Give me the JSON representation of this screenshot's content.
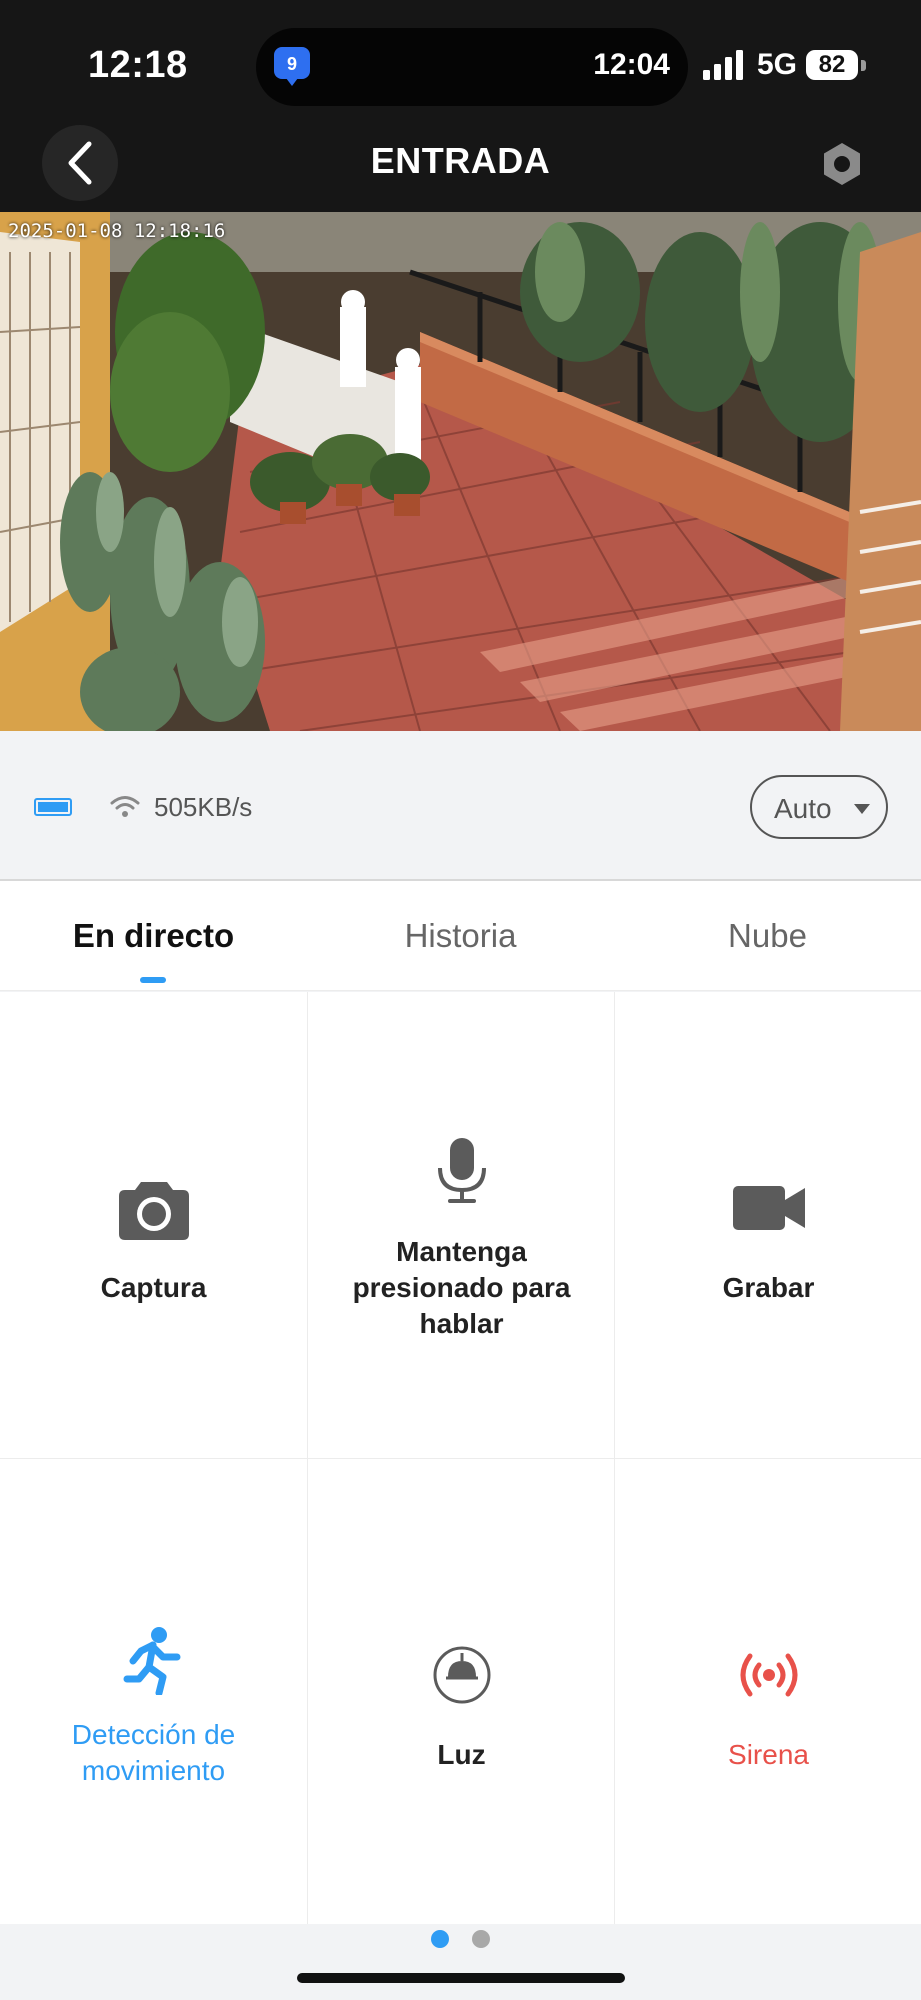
{
  "status_bar": {
    "time": "12:18",
    "island_time": "12:04",
    "island_badge": "9",
    "network": "5G",
    "battery": "82"
  },
  "header": {
    "title": "ENTRADA"
  },
  "video": {
    "timestamp": "2025-01-08 12:18:16"
  },
  "info_bar": {
    "speed": "505KB/s",
    "quality": "Auto"
  },
  "tabs": [
    {
      "label": "En directo",
      "active": true
    },
    {
      "label": "Historia",
      "active": false
    },
    {
      "label": "Nube",
      "active": false
    }
  ],
  "controls": [
    {
      "label": "Captura",
      "icon": "camera-icon"
    },
    {
      "label": "Mantenga presionado para hablar",
      "icon": "microphone-icon"
    },
    {
      "label": "Grabar",
      "icon": "video-camera-icon"
    },
    {
      "label": "Detección de movimiento",
      "icon": "running-person-icon"
    },
    {
      "label": "Luz",
      "icon": "lamp-icon"
    },
    {
      "label": "Sirena",
      "icon": "siren-icon"
    }
  ],
  "pager": {
    "pages": 2,
    "current": 1
  },
  "colors": {
    "accent": "#2f9cf4",
    "siren": "#e8514a",
    "header_bg": "#161616",
    "icon_gray": "#5b5b5b"
  }
}
